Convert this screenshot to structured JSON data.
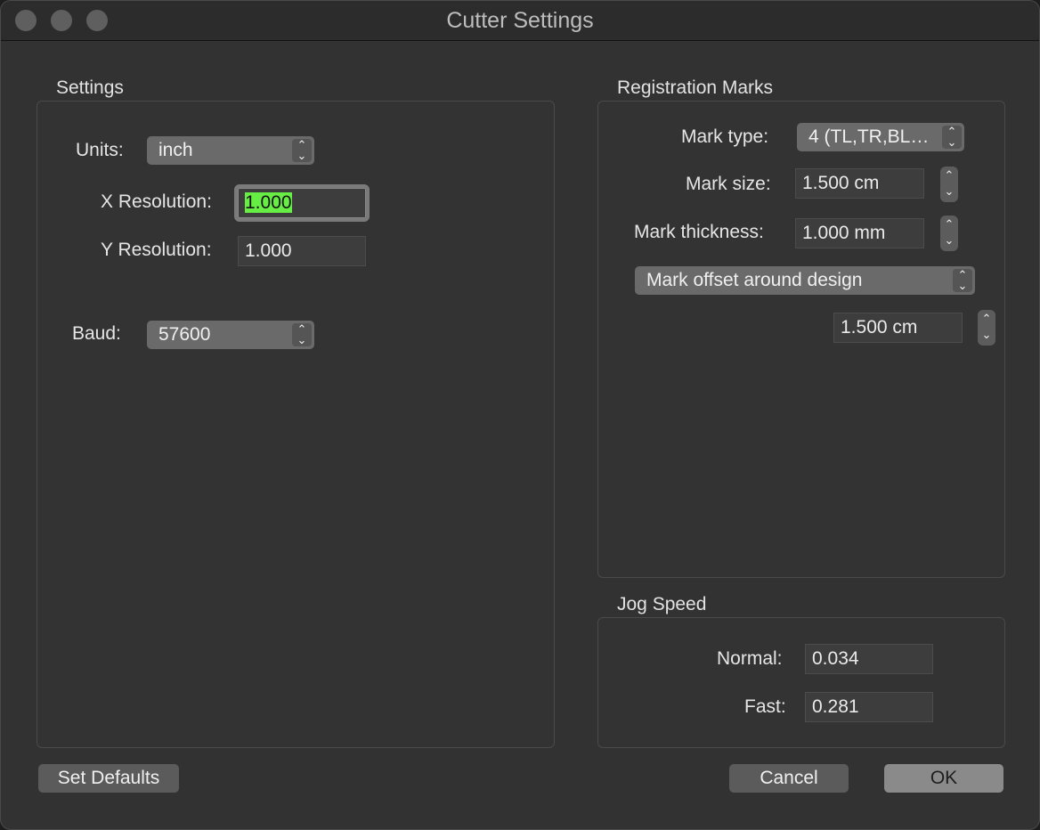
{
  "window": {
    "title": "Cutter Settings"
  },
  "settings": {
    "group_label": "Settings",
    "units_label": "Units:",
    "units_value": "inch",
    "x_res_label": "X Resolution:",
    "x_res_value": "1.000",
    "y_res_label": "Y Resolution:",
    "y_res_value": "1.000",
    "baud_label": "Baud:",
    "baud_value": "57600"
  },
  "registration": {
    "group_label": "Registration Marks",
    "mark_type_label": "Mark type:",
    "mark_type_value": "4 (TL,TR,BL…",
    "mark_size_label": "Mark size:",
    "mark_size_value": "1.500 cm",
    "mark_thickness_label": "Mark thickness:",
    "mark_thickness_value": "1.000 mm",
    "offset_mode_value": "Mark offset around design",
    "offset_value": "1.500 cm"
  },
  "jog": {
    "group_label": "Jog Speed",
    "normal_label": "Normal:",
    "normal_value": "0.034",
    "fast_label": "Fast:",
    "fast_value": "0.281"
  },
  "buttons": {
    "set_defaults": "Set Defaults",
    "cancel": "Cancel",
    "ok": "OK"
  },
  "colors": {
    "selection_highlight": "#66ee44"
  }
}
